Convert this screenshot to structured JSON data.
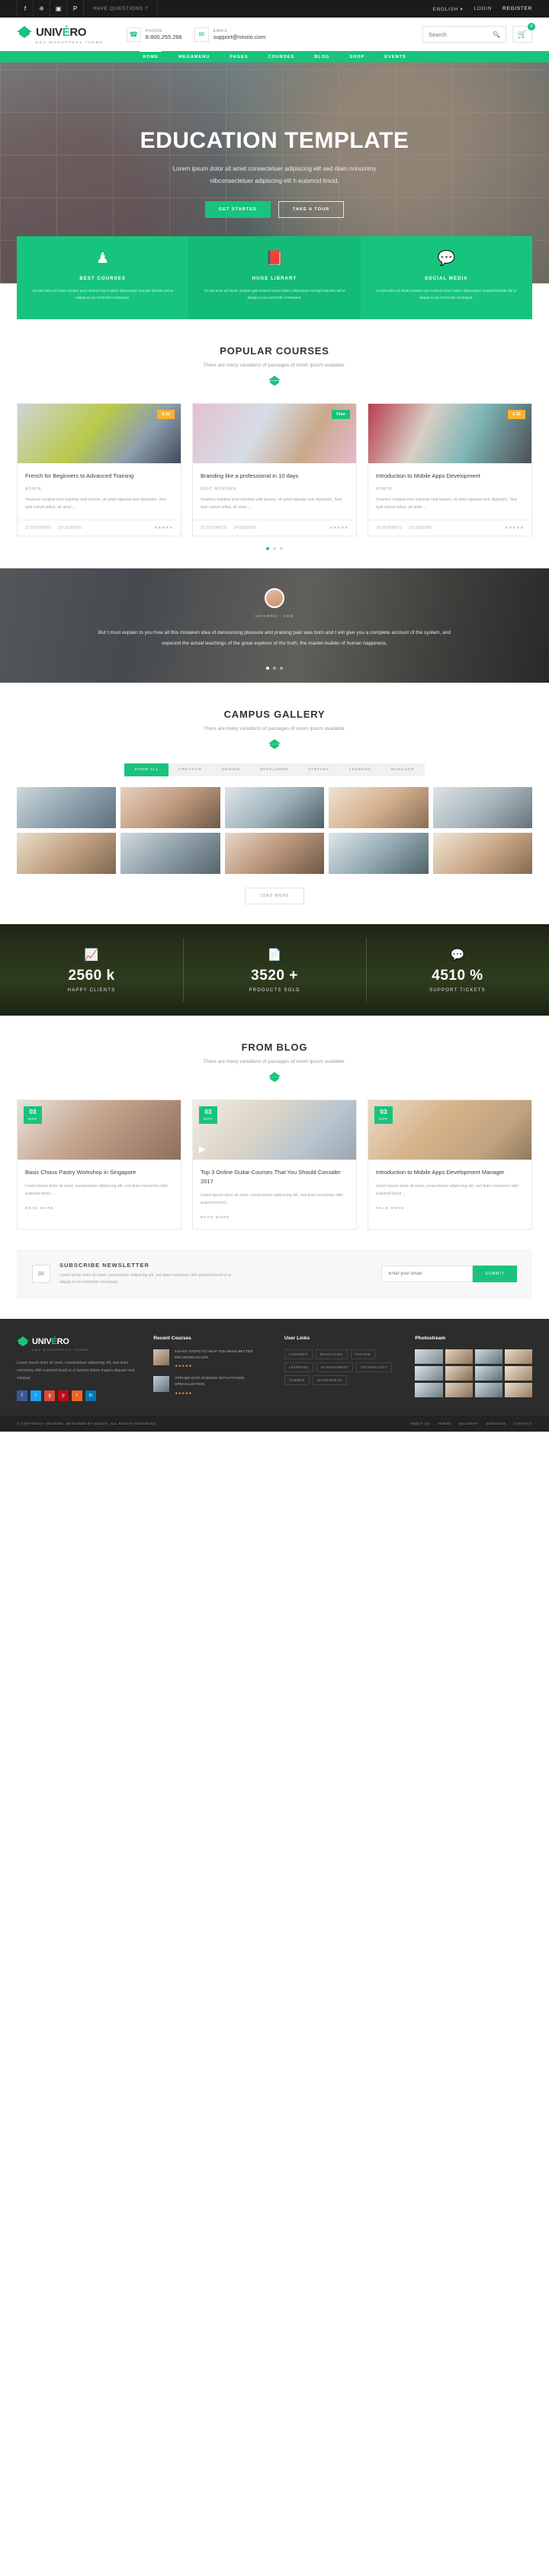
{
  "topbar": {
    "social": [
      {
        "name": "facebook-icon",
        "glyph": "f"
      },
      {
        "name": "twitter-icon",
        "glyph": "❈"
      },
      {
        "name": "instagram-icon",
        "glyph": "▣"
      },
      {
        "name": "pinterest-icon",
        "glyph": "P"
      }
    ],
    "have_questions": "HAVE QUESTIONS ?",
    "language": "ENGLISH",
    "language_caret": "▾",
    "login": "LOGIN",
    "register": "REGISTER"
  },
  "header": {
    "logo_pre": "UNIV",
    "logo_accent": "É",
    "logo_post": "RO",
    "logo_sub": "EDU WORDPRESS THEME",
    "phone_label": "PHONE :",
    "phone_value": "8.800.255.266",
    "email_label": "EMAIL :",
    "email_value": "support@ninzio.com",
    "search_placeholder": "Search",
    "cart_count": "0"
  },
  "nav": {
    "items": [
      {
        "label": "HOME",
        "active": true
      },
      {
        "label": "MEGAMENU",
        "active": false
      },
      {
        "label": "PAGES",
        "active": false
      },
      {
        "label": "COURSES",
        "active": false
      },
      {
        "label": "BLOG",
        "active": false
      },
      {
        "label": "SHOP",
        "active": false
      },
      {
        "label": "EVENTS",
        "active": false
      }
    ]
  },
  "hero": {
    "title": "EDUCATION TEMPLATE",
    "subtitle_line1": "Lorem ipsum dolor sit amet consectetuer adipiscing elit sed diam nonummy",
    "subtitle_line2": "nibconsectetuer adipiscing elit h euismod tincid.",
    "btn_primary": "GET STARTED",
    "btn_secondary": "TAKE A TOUR"
  },
  "features": [
    {
      "icon": "graduate-cap-icon",
      "glyph": "♟",
      "title": "BEST COURSES",
      "text": "Ut wisi enim ad minim veniam quis nostrud exerci tation ullamcorper suscipit lobortis nisl ut aliquip ex ea commodo consequat."
    },
    {
      "icon": "book-icon",
      "glyph": "📕",
      "title": "HUGE LIBRARY",
      "text": "Ut wisi enim ad minim veniam quis nostrud exerci tation ullamcorper suscipit lobortis nisl ut aliquip ex ea commodo consequat."
    },
    {
      "icon": "chat-bubble-icon",
      "glyph": "💬",
      "title": "SOCIAL MEDIA",
      "text": "Ut wisi enim ad minim veniam quis nostrud exerci tation ullamcorper suscipit lobortis nisl ut aliquip ex ea commodo consequat."
    }
  ],
  "popular_courses": {
    "title": "POPULAR COURSES",
    "subtitle": "There are many variations of passages of lorem Ipsum available.",
    "cards": [
      {
        "title": "French for Beginners to Advanced Training",
        "author": "ADMIN",
        "desc": "Vivamus volutpat eros pulvinar velit laoreet, sit amet egestas erat dignissim. Sed quis rutrum tellus, sit amet ...",
        "tag": "$ 20",
        "tag_type": "price",
        "students": "12 STUDENTS",
        "lessons": "10 LESSONS",
        "stars": "★★★★★"
      },
      {
        "title": "Branding like a professional in 10 days",
        "author": "ERIC MORGAN",
        "desc": "Vivamus volutpat eros pulvinar velit laoreet, sit amet egestas erat dignissim. Sed quis rutrum tellus, sit amet ...",
        "tag": "Free",
        "tag_type": "free",
        "students": "22 STUDENTS",
        "lessons": "14 LESSONS",
        "stars": "★★★★★"
      },
      {
        "title": "Introduction to Mobile Apps Development",
        "author": "ADMIN",
        "desc": "Vivamus volutpat eros pulvinar velit laoreet, sit amet egestas erat dignissim. Sed quis rutrum tellus, sit amet ...",
        "tag": "$ 35",
        "tag_type": "price",
        "students": "18 STUDENTS",
        "lessons": "12 LESSONS",
        "stars": "★★★★★"
      }
    ]
  },
  "testimonial": {
    "author": "UNIVERO - CEO",
    "quote": "But I must explain to you how all this mistaken idea of denouncing pleasure and praising pain was born and I will give you a complete account of the system, and expound the actual teachings of the great explorer of the truth, the master-builder of human happiness."
  },
  "gallery": {
    "title": "CAMPUS GALLERY",
    "subtitle": "There are many variations of passages of lorem Ipsum available.",
    "filters": [
      {
        "label": "SHOW ALL",
        "active": true
      },
      {
        "label": "CREATIVE",
        "active": false
      },
      {
        "label": "DESIGN",
        "active": false
      },
      {
        "label": "DEVELOPER",
        "active": false
      },
      {
        "label": "FANTASY",
        "active": false
      },
      {
        "label": "LESSONS",
        "active": false
      },
      {
        "label": "MANAGER",
        "active": false
      }
    ],
    "load_more": "LOAD MORE"
  },
  "counters": [
    {
      "icon": "chart-icon",
      "glyph": "📈",
      "value": "2560 k",
      "label": "HAPPY CLIENTS"
    },
    {
      "icon": "document-icon",
      "glyph": "📄",
      "value": "3520 +",
      "label": "PRODUCTS SOLD"
    },
    {
      "icon": "chat-icon",
      "glyph": "💬",
      "value": "4510 %",
      "label": "SUPPORT TICKETS"
    }
  ],
  "blog": {
    "title": "FROM BLOG",
    "subtitle": "There are many variations of passages of lorem Ipsum available.",
    "posts": [
      {
        "day": "03",
        "month": "NOV",
        "title": "Basic Choux Pastry Workshop in Singapore",
        "excerpt": "Lorem ipsum dolor sit amet, consectetuer adipiscing elit, sed diam nonummy nibh euismod tincid ...",
        "read_more": "READ MORE",
        "has_play": false
      },
      {
        "day": "03",
        "month": "NOV",
        "title": "Top 3 Online Guitar Courses That You Should Consider 2017",
        "excerpt": "Lorem ipsum dolor sit amet, consectetuer adipiscing elit, sed diam nonummy nibh euismod tincid ...",
        "read_more": "READ MORE",
        "has_play": true
      },
      {
        "day": "03",
        "month": "NOV",
        "title": "Introduction to Mobile Apps Development Manager",
        "excerpt": "Lorem ipsum dolor sit amet, consectetuer adipiscing elit, sed diam nonummy nibh euismod tincid ...",
        "read_more": "READ MORE",
        "has_play": false
      }
    ]
  },
  "subscribe": {
    "title": "SUBSCRIBE NEWSLETTER",
    "text": "Lorem ipsum dolor sit amet, consectetuer adipiscing elit, sed diam nonummy nibh euismod tincid ut ut aliquip ex ea commodo consequat.",
    "placeholder": "Enter your email",
    "button": "SUBMIT"
  },
  "footer": {
    "logo_pre": "UNIV",
    "logo_accent": "É",
    "logo_post": "RO",
    "logo_sub": "EDU WORDPRESS THEME",
    "about": "Lorem ipsum dolor sit amet, consectetuer adipiscing elit, sed diam nonummy nibh euismod tincid ut ut laoreet dolore magna aliquam erat volutpat.",
    "social": [
      {
        "name": "facebook-icon",
        "glyph": "f",
        "color": "#3b5998"
      },
      {
        "name": "twitter-icon",
        "glyph": "t",
        "color": "#1da1f2"
      },
      {
        "name": "google-icon",
        "glyph": "g",
        "color": "#dd4b39"
      },
      {
        "name": "pinterest-icon",
        "glyph": "p",
        "color": "#bd081c"
      },
      {
        "name": "rss-icon",
        "glyph": "r",
        "color": "#f26522"
      },
      {
        "name": "linkedin-icon",
        "glyph": "in",
        "color": "#0077b5"
      }
    ],
    "recent_title": "Recent Courses",
    "recent": [
      {
        "title": "5 EASY STEPS TO HELP YOU MAKE BETTER DECISIONS IN LIFE",
        "stars": "★★★★★"
      },
      {
        "title": "APPLIED DATA SCIENCE WITH PYTHON SPECIALIZATION",
        "stars": "★★★★★"
      }
    ],
    "links_title": "User Links",
    "tags": [
      "COURSES",
      "EDUCATION",
      "FUTURE",
      "LEARNING",
      "MANAGEMENT",
      "TECHNOLOGY",
      "THEMES",
      "WORDPRESS"
    ],
    "photo_title": "Photostream"
  },
  "copyright": {
    "text": "© COPYRIGHT UNIVERO. DESIGNED BY NINZIO. ALL RIGHTS RESERVED.",
    "links": [
      "ABOUT US",
      "TERMS",
      "DELIVERY",
      "SERVICES",
      "CONTACT"
    ]
  }
}
